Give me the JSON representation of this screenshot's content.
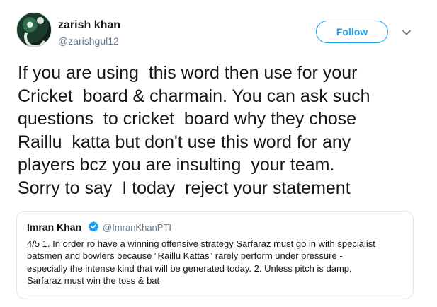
{
  "tweet": {
    "author": {
      "display_name": "zarish khan",
      "handle": "@zarishgul12"
    },
    "follow_label": "Follow",
    "text_lines": [
      "If you are using  this word then use for your",
      "Cricket  board & charmain. You can ask such",
      "questions  to cricket  board why they chose",
      "Raillu  katta but don't use this word for any",
      "players bcz you are insulting  your team.",
      "Sorry to say  I today  reject your statement"
    ]
  },
  "quoted_tweet": {
    "author_name": "Imran Khan",
    "author_handle": "@ImranKhanPTI",
    "verified": true,
    "text_lines": [
      "4/5 1. In order ro have a winning offensive strategy Sarfaraz must go in with specialist",
      "batsmen and bowlers because \"Raillu Kattas\" rarely perform under pressure -",
      "especially the intense kind that will be generated today. 2. Unless pitch is damp,",
      "Sarfaraz must win the toss & bat"
    ]
  },
  "icons": {
    "caret": "chevron-down-icon",
    "verified": "verified-badge-icon"
  },
  "colors": {
    "accent": "#1da1f2",
    "text": "#14171a",
    "secondary_text": "#657786",
    "border": "#e1e8ed"
  }
}
